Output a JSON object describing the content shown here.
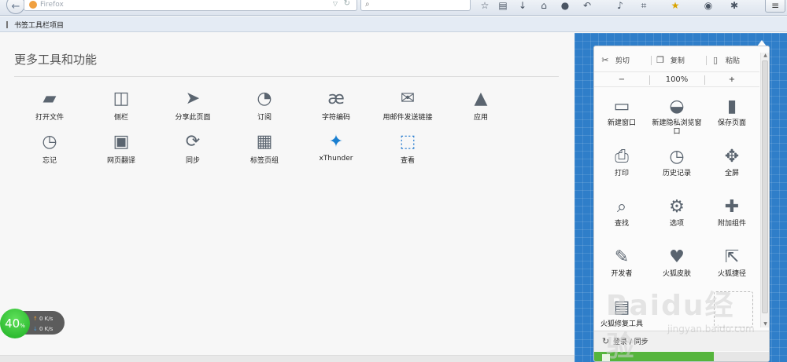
{
  "toolbar": {
    "url_placeholder": "Firefox",
    "search_placeholder": "",
    "icons": [
      "star-icon",
      "reading-list-icon",
      "download-icon",
      "home-icon",
      "chat-icon",
      "undo-icon",
      "volume-icon",
      "crop-icon",
      "bookmark-star-icon",
      "speech-icon",
      "sparkle-icon"
    ],
    "menu_icon": "hamburger-menu-icon"
  },
  "bookmarks": {
    "label": "书签工具栏项目"
  },
  "customize": {
    "title": "更多工具和功能",
    "tools": [
      {
        "label": "打开文件",
        "icon": "folder-icon"
      },
      {
        "label": "侧栏",
        "icon": "sidebar-icon"
      },
      {
        "label": "分享此页面",
        "icon": "share-icon"
      },
      {
        "label": "订阅",
        "icon": "rss-icon"
      },
      {
        "label": "字符编码",
        "icon": "encoding-icon"
      },
      {
        "label": "用邮件发送链接",
        "icon": "mail-icon"
      },
      {
        "label": "应用",
        "icon": "rocket-icon"
      },
      {
        "label": "忘记",
        "icon": "forget-icon"
      },
      {
        "label": "网页翻译",
        "icon": "translate-icon"
      },
      {
        "label": "同步",
        "icon": "sync-icon"
      },
      {
        "label": "标签页组",
        "icon": "tab-groups-icon"
      },
      {
        "label": "xThunder",
        "icon": "xthunder-icon"
      },
      {
        "label": "查看",
        "icon": "inspect-icon"
      }
    ]
  },
  "speed_widget": {
    "percent": "40",
    "percent_sign": "%",
    "upload": "0 K/s",
    "download": "0 K/s"
  },
  "menu_panel": {
    "cut_label": "剪切",
    "copy_label": "复制",
    "paste_label": "粘贴",
    "zoom_out": "−",
    "zoom_level": "100%",
    "zoom_in": "+",
    "items": [
      {
        "label": "新建窗口",
        "icon": "new-window-icon"
      },
      {
        "label": "新建隐私浏览窗口",
        "icon": "private-mask-icon"
      },
      {
        "label": "保存页面",
        "icon": "save-page-icon"
      },
      {
        "label": "打印",
        "icon": "print-icon"
      },
      {
        "label": "历史记录",
        "icon": "history-clock-icon"
      },
      {
        "label": "全屏",
        "icon": "fullscreen-icon"
      },
      {
        "label": "查找",
        "icon": "find-magnifier-icon"
      },
      {
        "label": "选项",
        "icon": "options-gear-icon"
      },
      {
        "label": "附加组件",
        "icon": "addons-puzzle-icon"
      },
      {
        "label": "开发者",
        "icon": "developer-wrench-icon"
      },
      {
        "label": "火狐皮肤",
        "icon": "themes-shirt-icon"
      },
      {
        "label": "火狐捷径",
        "icon": "shortcut-share-icon"
      },
      {
        "label": "火狐修复工具",
        "icon": "repair-tool-icon"
      }
    ],
    "sync_label": "登录 / 同步"
  },
  "watermark": {
    "text": "Baidu经验",
    "url": "jingyan.baidu.com"
  }
}
